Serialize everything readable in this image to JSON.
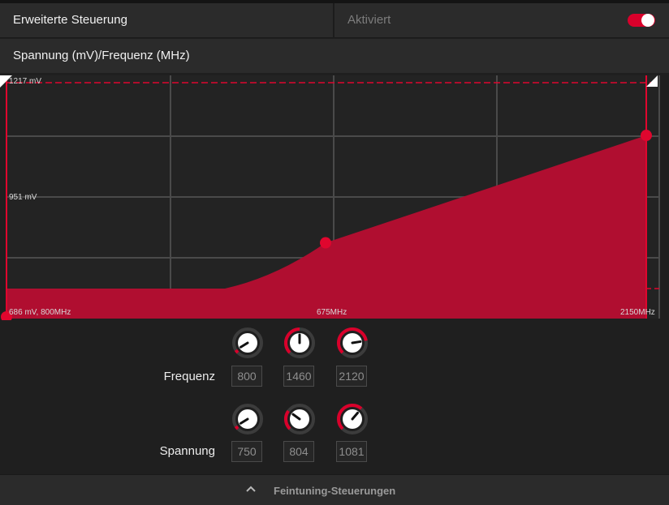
{
  "header": {
    "title": "Erweiterte Steuerung",
    "status": "Aktiviert",
    "toggle_on": true
  },
  "section": {
    "title": "Spannung (mV)/Frequenz (MHz)"
  },
  "chart_data": {
    "type": "area",
    "x": [
      800,
      1460,
      2150
    ],
    "y": [
      686,
      804,
      1081
    ],
    "labels": {
      "top_left": "1217 mV",
      "mid_left": "951 mV",
      "bottom_left": "686 mV, 800MHz",
      "bottom_mid": "675MHz",
      "bottom_right": "2150MHz"
    },
    "colors": {
      "fill": "#b00e30",
      "line": "#e0062e",
      "grid": "#4a4a4a"
    }
  },
  "frequency": {
    "label": "Frequenz",
    "values": [
      "800",
      "1460",
      "2120"
    ],
    "levels": [
      0.05,
      0.5,
      0.8
    ]
  },
  "voltage": {
    "label": "Spannung",
    "values": [
      "750",
      "804",
      "1081"
    ],
    "levels": [
      0.05,
      0.3,
      0.65
    ]
  },
  "footer": {
    "label": "Feintuning-Steuerungen",
    "icon": "chevron-up-icon"
  }
}
